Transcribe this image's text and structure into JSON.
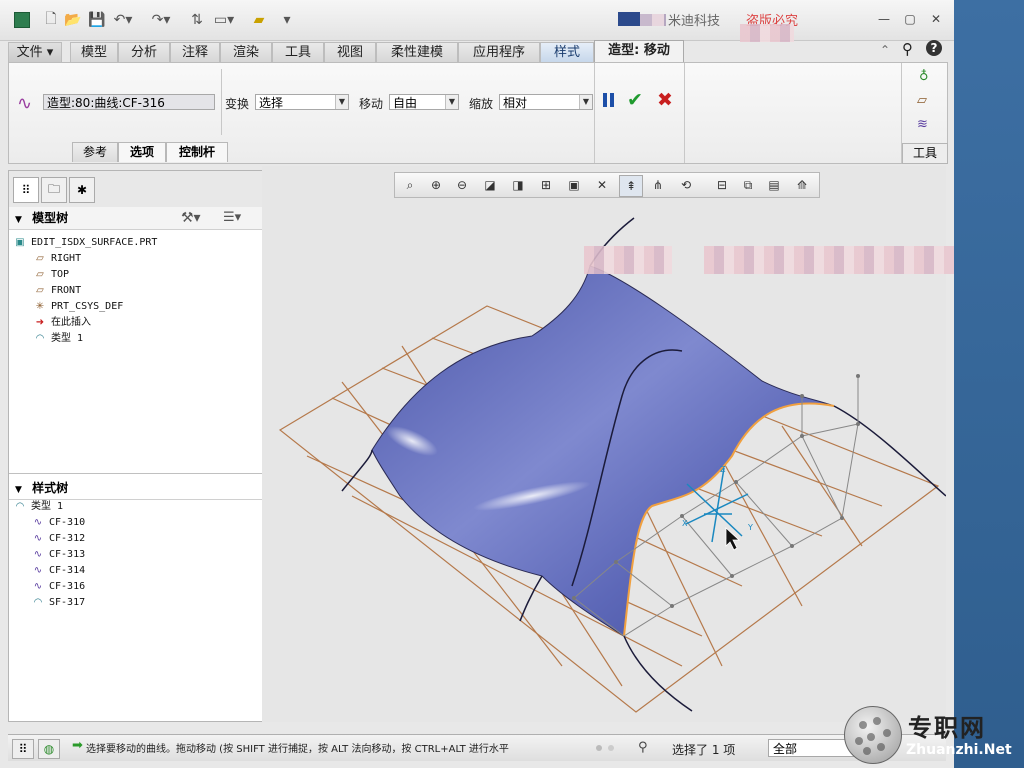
{
  "title_bar": {
    "company_text": "米迪科技",
    "red_text": "盗版必究"
  },
  "ribbon_tabs": [
    {
      "label": "文件 ▾",
      "kind": "file"
    },
    {
      "label": "模型",
      "kind": "normal"
    },
    {
      "label": "分析",
      "kind": "normal"
    },
    {
      "label": "注释",
      "kind": "normal"
    },
    {
      "label": "渲染",
      "kind": "normal"
    },
    {
      "label": "工具",
      "kind": "normal"
    },
    {
      "label": "视图",
      "kind": "normal"
    },
    {
      "label": "柔性建模",
      "kind": "normal"
    },
    {
      "label": "应用程序",
      "kind": "normal"
    },
    {
      "label": "样式",
      "kind": "style"
    },
    {
      "label": "造型: 移动",
      "kind": "active"
    }
  ],
  "ribbon": {
    "curve_field": "造型:80:曲线:CF-316",
    "transform_label": "变换",
    "transform_value": "选择",
    "move_label": "移动",
    "move_value": "自由",
    "scale_label": "缩放",
    "scale_value": "相对",
    "subtabs": [
      "参考",
      "选项",
      "控制杆"
    ],
    "tools_label": "工具"
  },
  "model_tree": {
    "heading": "模型树",
    "items": [
      {
        "text": "EDIT_ISDX_SURFACE.PRT",
        "icon": "part-icon",
        "glyph": "▣"
      },
      {
        "text": "RIGHT",
        "icon": "datum-plane-icon",
        "glyph": "▱"
      },
      {
        "text": "TOP",
        "icon": "datum-plane-icon",
        "glyph": "▱"
      },
      {
        "text": "FRONT",
        "icon": "datum-plane-icon",
        "glyph": "▱"
      },
      {
        "text": "PRT_CSYS_DEF",
        "icon": "csys-icon",
        "glyph": "✳"
      },
      {
        "text": "在此插入",
        "icon": "insert-arrow-icon",
        "glyph": "➜"
      },
      {
        "text": "类型 1",
        "icon": "style-feature-icon",
        "glyph": "◠"
      }
    ]
  },
  "style_tree": {
    "heading": "样式树",
    "items": [
      {
        "text": "类型 1",
        "icon": "style-feature-icon",
        "glyph": "◠"
      },
      {
        "text": "CF-310",
        "icon": "curve-icon",
        "glyph": "∿"
      },
      {
        "text": "CF-312",
        "icon": "curve-icon",
        "glyph": "∿"
      },
      {
        "text": "CF-313",
        "icon": "curve-icon",
        "glyph": "∿"
      },
      {
        "text": "CF-314",
        "icon": "curve-icon",
        "glyph": "∿"
      },
      {
        "text": "CF-316",
        "icon": "curve-icon",
        "glyph": "∿"
      },
      {
        "text": "SF-317",
        "icon": "surface-icon",
        "glyph": "◠"
      }
    ]
  },
  "status": {
    "message": "选择要移动的曲线。拖动移动 (按 SHIFT 进行捕捉，按 ALT 法向移动，按 CTRL+ALT 进行水平",
    "selected": "选择了 1 项",
    "filter": "全部"
  },
  "watermark": {
    "cn": "专职网",
    "en": "Zhuanzhi.Net"
  },
  "colors": {
    "surface": "#6d79c4",
    "datum_grid": "#b5794b",
    "accept": "#1f9a2e",
    "cancel": "#c81f1f",
    "pause": "#1d4fa8"
  }
}
